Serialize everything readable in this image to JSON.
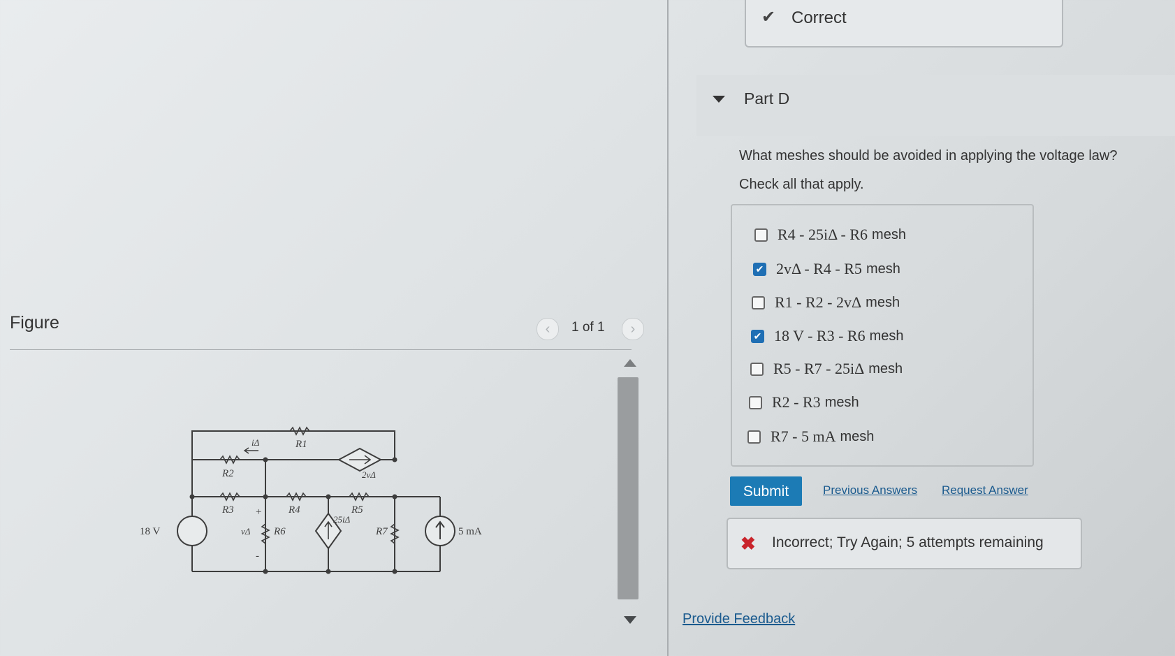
{
  "figure": {
    "label": "Figure",
    "pager": {
      "prev_icon": "chevron-left-icon",
      "text": "1 of 1",
      "next_icon": "chevron-right-icon"
    },
    "circuit": {
      "source_label": "18 V",
      "current_source_label": "5 mA",
      "labels": [
        "R1",
        "R2",
        "R3",
        "R4",
        "R5",
        "R6",
        "R7",
        "iΔ",
        "vΔ",
        "2vΔ",
        "25iΔ",
        "+",
        "-"
      ]
    }
  },
  "status": {
    "correct_label": "Correct"
  },
  "part": {
    "title": "Part D",
    "question": "What meshes should be avoided in applying the voltage law?",
    "instruction": "Check all that apply.",
    "options": [
      {
        "math": "R4 - 25iΔ - R6",
        "suffix": "mesh",
        "checked": false
      },
      {
        "math": "2vΔ - R4 - R5",
        "suffix": "mesh",
        "checked": true
      },
      {
        "math": "R1 - R2 - 2vΔ",
        "suffix": "mesh",
        "checked": false
      },
      {
        "math": "18 V - R3 - R6",
        "suffix": "mesh",
        "checked": true
      },
      {
        "math": "R5 - R7 - 25iΔ",
        "suffix": "mesh",
        "checked": false
      },
      {
        "math": "R2 - R3",
        "suffix": "mesh",
        "checked": false
      },
      {
        "math": "R7 - 5 mA",
        "suffix": "mesh",
        "checked": false
      }
    ],
    "submit_label": "Submit",
    "previous_answers_label": "Previous Answers",
    "request_answer_label": "Request Answer",
    "incorrect_message": "Incorrect; Try Again; 5 attempts remaining"
  },
  "footer": {
    "feedback_label": "Provide Feedback"
  },
  "colors": {
    "accent": "#1c7bb5",
    "error": "#c9242b",
    "link": "#1a5a8e"
  }
}
